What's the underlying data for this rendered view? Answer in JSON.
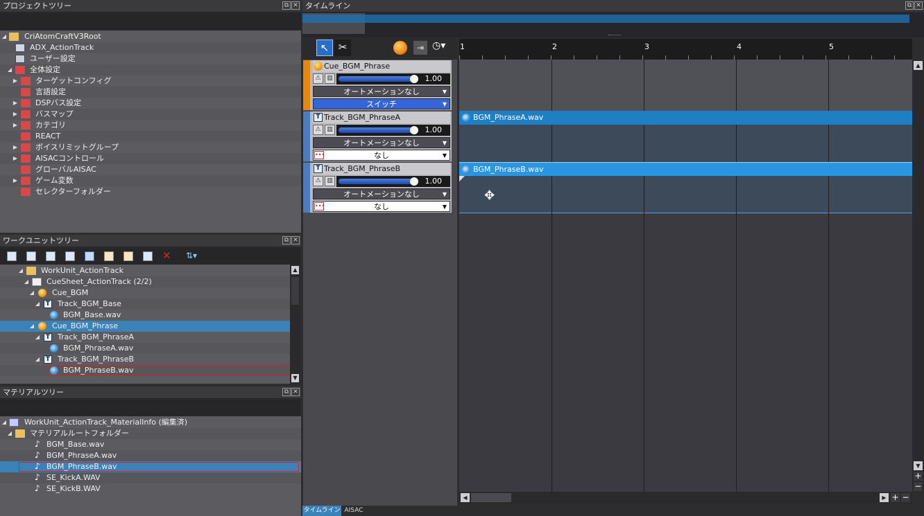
{
  "project_tree": {
    "title": "プロジェクトツリー",
    "items": [
      {
        "label": "CriAtomCraftV3Root"
      },
      {
        "label": "ADX_ActionTrack"
      },
      {
        "label": "ユーザー設定"
      },
      {
        "label": "全体設定"
      },
      {
        "label": "ターゲットコンフィグ"
      },
      {
        "label": "言語設定"
      },
      {
        "label": "DSPバス設定"
      },
      {
        "label": "バスマップ"
      },
      {
        "label": "カテゴリ"
      },
      {
        "label": "REACT"
      },
      {
        "label": "ボイスリミットグループ"
      },
      {
        "label": "AISACコントロール"
      },
      {
        "label": "グローバルAISAC"
      },
      {
        "label": "ゲーム変数"
      },
      {
        "label": "セレクターフォルダー"
      }
    ]
  },
  "workunit_tree": {
    "title": "ワークユニットツリー",
    "items": [
      {
        "label": "WorkUnit_ActionTrack"
      },
      {
        "label": "CueSheet_ActionTrack (2/2)"
      },
      {
        "label": "Cue_BGM"
      },
      {
        "label": "Track_BGM_Base"
      },
      {
        "label": "BGM_Base.wav"
      },
      {
        "label": "Cue_BGM_Phrase"
      },
      {
        "label": "Track_BGM_PhraseA"
      },
      {
        "label": "BGM_PhraseA.wav"
      },
      {
        "label": "Track_BGM_PhraseB"
      },
      {
        "label": "BGM_PhraseB.wav"
      }
    ]
  },
  "material_tree": {
    "title": "マテリアルツリー",
    "items": [
      {
        "label": "WorkUnit_ActionTrack_MaterialInfo (編集済)"
      },
      {
        "label": "マテリアルルートフォルダー"
      },
      {
        "label": "BGM_Base.wav"
      },
      {
        "label": "BGM_PhraseA.wav"
      },
      {
        "label": "BGM_PhraseB.wav"
      },
      {
        "label": "SE_KickA.WAV"
      },
      {
        "label": "SE_KickB.WAV"
      }
    ]
  },
  "timeline": {
    "title": "タイムライン",
    "ruler": [
      "1",
      "2",
      "3",
      "4",
      "5"
    ],
    "cue": {
      "name": "Cue_BGM_Phrase",
      "volume": "1.00",
      "automation": "オートメーションなし",
      "type": "スイッチ"
    },
    "tracks": [
      {
        "name": "Track_BGM_PhraseA",
        "volume": "1.00",
        "automation": "オートメーションなし",
        "option": "なし",
        "waveform": "BGM_PhraseA.wav"
      },
      {
        "name": "Track_BGM_PhraseB",
        "volume": "1.00",
        "automation": "オートメーションなし",
        "option": "なし",
        "waveform": "BGM_PhraseB.wav"
      }
    ]
  },
  "bottom_tabs": [
    "タイムライン",
    "AISAC"
  ],
  "colors": {
    "accent": "#3a82b8",
    "cue_bar": "#e8870e",
    "track_bar": "#4a7cc4",
    "wave_block": "#1e7fc4"
  }
}
